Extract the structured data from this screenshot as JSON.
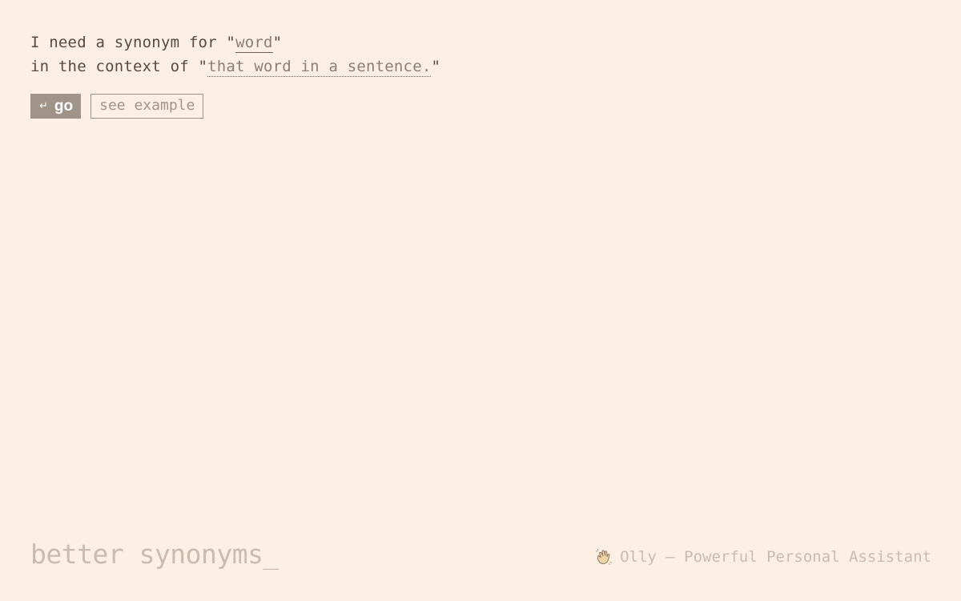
{
  "prompt": {
    "line1_prefix": "I need a synonym for \"",
    "word": "word",
    "line1_suffix": "\"",
    "line2_prefix": "in the context of \"",
    "context": "that word in a sentence.",
    "line2_suffix": "\""
  },
  "actions": {
    "go_glyph": "↵",
    "go_label": "go",
    "example_label": "see example"
  },
  "footer": {
    "brand": "better synonyms_",
    "promo_icon": "waving-hand-icon",
    "promo_text": "Olly – Powerful Personal Assistant"
  },
  "colors": {
    "background": "#fdefe4",
    "text": "#544c42",
    "accent": "#a09488",
    "muted": "#c9bcae"
  }
}
